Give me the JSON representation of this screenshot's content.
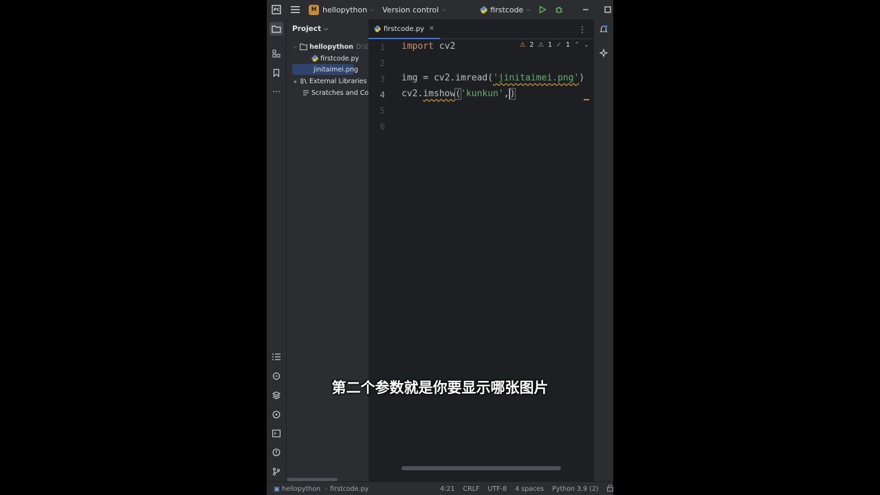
{
  "titlebar": {
    "project_badge": "H",
    "project_name": "hellopython",
    "vcs": "Version control",
    "run_config": "firstcode",
    "icons": [
      "app-icon",
      "hamburger-icon",
      "run-icon",
      "debug-icon",
      "minimize-icon",
      "maximize-icon",
      "close-icon"
    ]
  },
  "project_panel": {
    "title": "Project",
    "tree": [
      {
        "label": "hellopython",
        "hint": "D:\\Co",
        "icon": "folder-icon"
      },
      {
        "label": "firstcode.py",
        "icon": "python-file-icon"
      },
      {
        "label": "jinitaimei.png",
        "icon": "image-file-icon",
        "selected": true
      },
      {
        "label": "External Libraries",
        "icon": "library-icon"
      },
      {
        "label": "Scratches and Con",
        "icon": "scratches-icon"
      }
    ]
  },
  "editor": {
    "tab_label": "firstcode.py",
    "line_numbers": [
      "1",
      "2",
      "3",
      "4",
      "5",
      "6"
    ],
    "current_line": "4",
    "lines": {
      "l1_kw": "import",
      "l1_rest": " cv2",
      "l3_a": "img = cv2.imread(",
      "l3_str": "'jinitaimei.png'",
      "l3_end": ")",
      "l4_a": "cv2.",
      "l4_fn": "imshow",
      "l4_b": "(",
      "l4_str": "'kunkun'",
      "l4_c": ",",
      "l4_end": ")"
    },
    "inspections": {
      "warnings": "2",
      "weak": "1",
      "ok": "1"
    }
  },
  "statusbar": {
    "project": "hellopython",
    "file": "firstcode.py",
    "position": "4:21",
    "line_sep": "CRLF",
    "encoding": "UTF-8",
    "indent": "4 spaces",
    "interpreter": "Python 3.9 (2)"
  },
  "subtitle": "第二个参数就是你要显示哪张图片",
  "colors": {
    "accent": "#3574f0",
    "keyword": "#cf8e6d",
    "string": "#6aab73",
    "background": "#1e1f22",
    "panel": "#2b2d30"
  }
}
